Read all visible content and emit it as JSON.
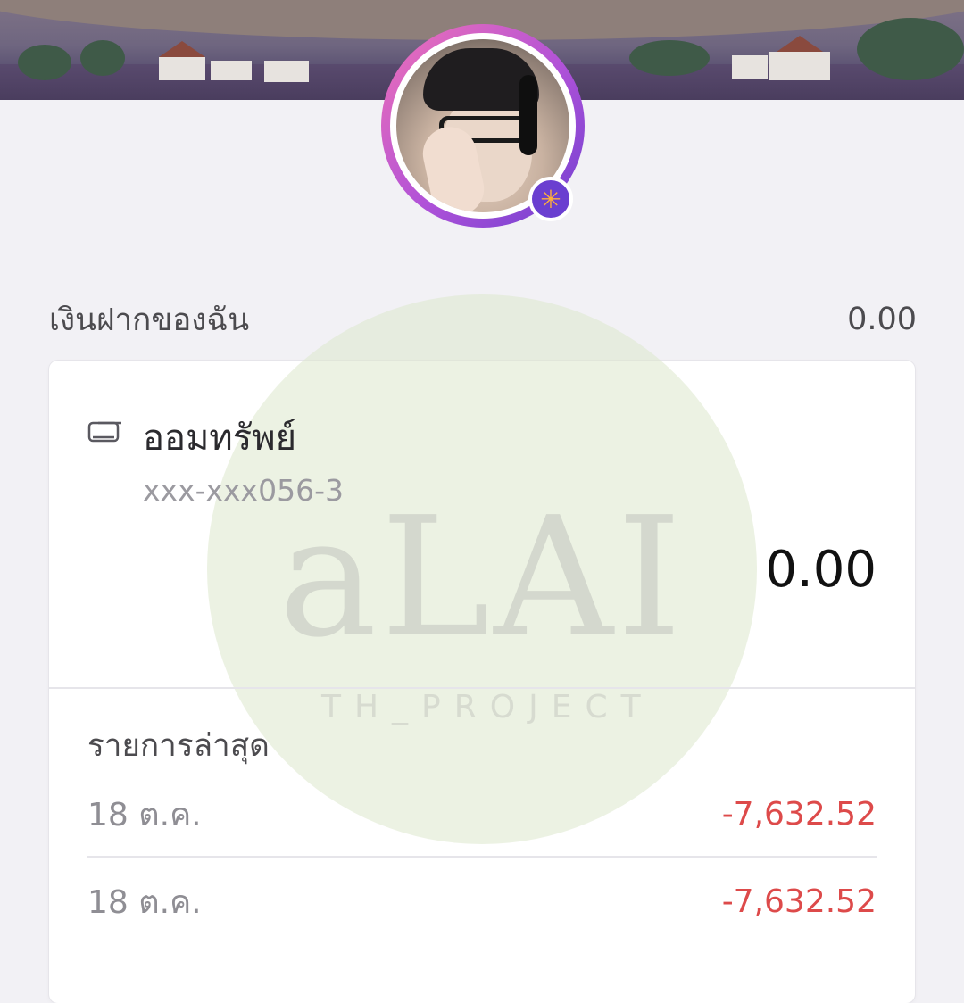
{
  "deposits": {
    "label": "เงินฝากของฉัน",
    "total": "0.00"
  },
  "account": {
    "icon": "card-icon",
    "name": "ออมทรัพย์",
    "number": "xxx-xxx056-3",
    "balance": "0.00"
  },
  "recent": {
    "title": "รายการล่าสุด",
    "items": [
      {
        "date": "18 ต.ค.",
        "amount": "-7,632.52"
      },
      {
        "date": "18 ต.ค.",
        "amount": "-7,632.52"
      }
    ]
  },
  "watermark": {
    "main": "aLAI",
    "sub": "TH_PROJECT"
  },
  "colors": {
    "negative": "#dd4a4a",
    "ring_start": "#f071b6",
    "ring_end": "#6d3fd0",
    "badge": "#6a3fd0"
  }
}
